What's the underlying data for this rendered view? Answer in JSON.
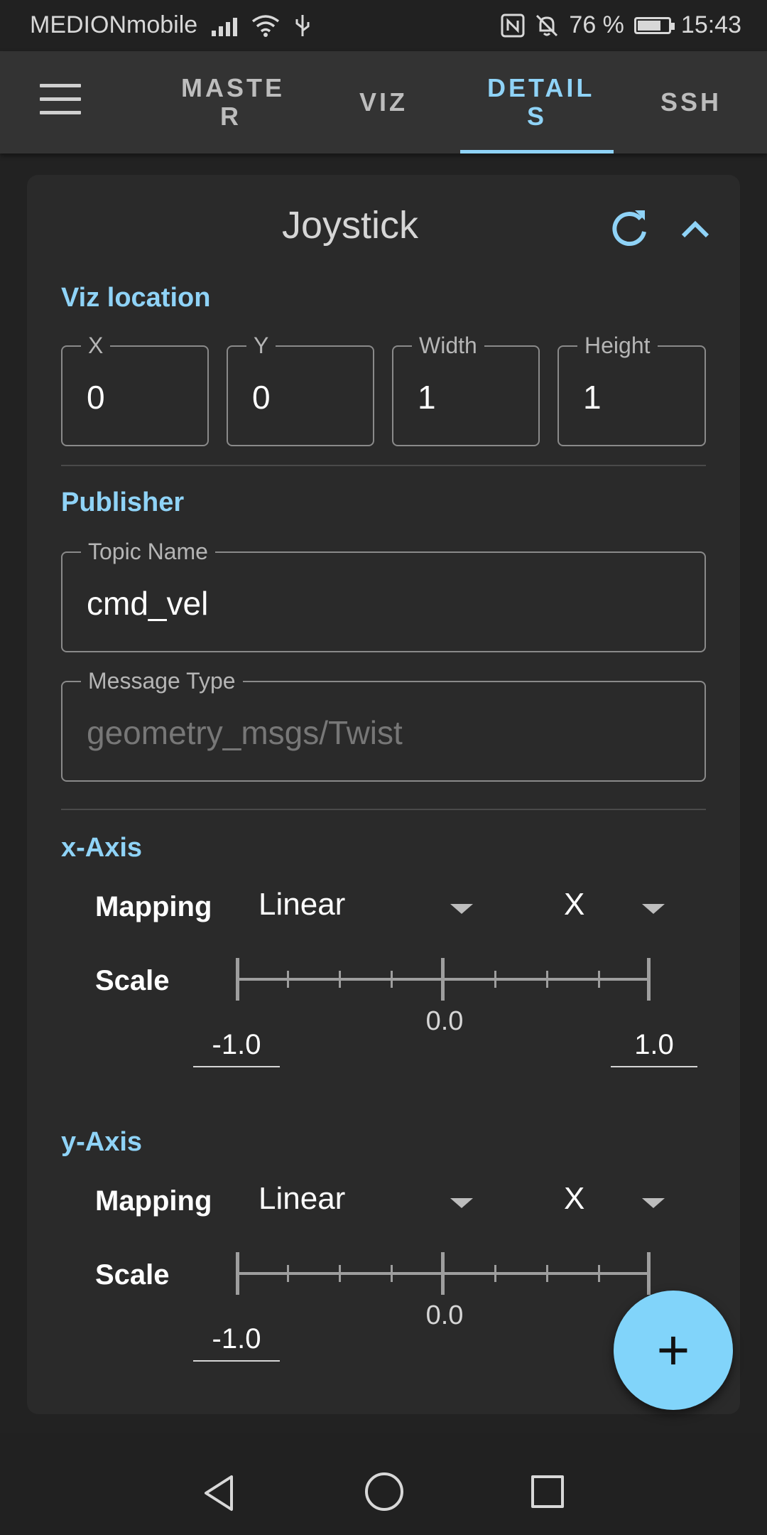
{
  "status_bar": {
    "carrier": "MEDIONmobile",
    "battery_text": "76 %",
    "battery_level": 0.76,
    "time": "15:43"
  },
  "app_bar": {
    "tabs": [
      {
        "label": "MASTE\nR",
        "active": false
      },
      {
        "label": "VIZ",
        "active": false
      },
      {
        "label": "DETAIL\nS",
        "active": true
      },
      {
        "label": "SSH",
        "active": false
      }
    ]
  },
  "card": {
    "title": "Joystick",
    "viz_location": {
      "label": "Viz location",
      "fields": [
        {
          "label": "X",
          "value": "0"
        },
        {
          "label": "Y",
          "value": "0"
        },
        {
          "label": "Width",
          "value": "1"
        },
        {
          "label": "Height",
          "value": "1"
        }
      ]
    },
    "publisher": {
      "label": "Publisher",
      "topic_label": "Topic Name",
      "topic_value": "cmd_vel",
      "type_label": "Message Type",
      "type_value": "geometry_msgs/Twist"
    },
    "x_axis": {
      "label": "x-Axis",
      "mapping_label": "Mapping",
      "mapping_value": "Linear",
      "axis_value": "X",
      "scale_label": "Scale",
      "scale_mid": "0.0",
      "scale_min": "-1.0",
      "scale_max": "1.0"
    },
    "y_axis": {
      "label": "y-Axis",
      "mapping_label": "Mapping",
      "mapping_value": "Linear",
      "axis_value": "X",
      "scale_label": "Scale",
      "scale_mid": "0.0",
      "scale_min": "-1.0"
    }
  },
  "fab": {
    "label": "+"
  },
  "icons": {
    "menu": "hamburger-menu-icon",
    "refresh": "refresh-icon",
    "collapse": "chevron-up-icon",
    "back": "nav-back-icon",
    "home": "nav-home-icon",
    "recent": "nav-recent-apps-icon"
  },
  "colors": {
    "accent": "#8fd3f7",
    "fab": "#81d4fa",
    "background": "#222222",
    "card": "#2a2a2a"
  }
}
